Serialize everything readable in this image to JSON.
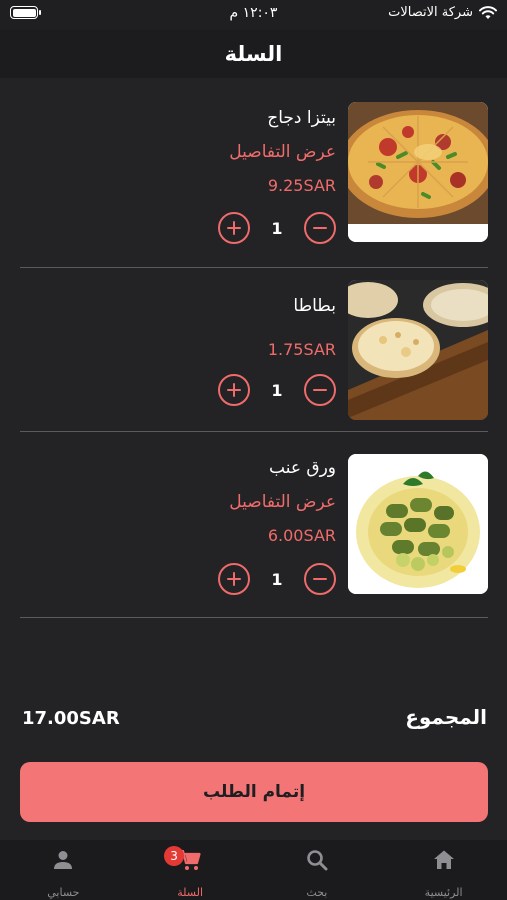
{
  "status_bar": {
    "carrier": "شركة الاتصالات",
    "time": "١٢:٠٣ م"
  },
  "header": {
    "title": "السلة"
  },
  "items": [
    {
      "name": "بيتزا دجاج",
      "details_link": "عرض التفاصيل",
      "price": "9.25SAR",
      "quantity": "1",
      "image": "pizza"
    },
    {
      "name": "بطاطا",
      "details_link": "",
      "price": "1.75SAR",
      "quantity": "1",
      "image": "manakish"
    },
    {
      "name": "ورق عنب",
      "details_link": "عرض التفاصيل",
      "price": "6.00SAR",
      "quantity": "1",
      "image": "grape-leaves"
    }
  ],
  "summary": {
    "total_label": "المجموع",
    "total_value": "17.00SAR"
  },
  "checkout": {
    "label": "إتمام الطلب"
  },
  "tabbar": {
    "tabs": [
      {
        "label": "الرئيسية",
        "icon": "home-icon"
      },
      {
        "label": "بحث",
        "icon": "search-icon"
      },
      {
        "label": "السلة",
        "icon": "cart-icon",
        "badge": "3",
        "active": true
      },
      {
        "label": "حسابي",
        "icon": "person-icon"
      }
    ]
  },
  "colors": {
    "accent": "#f06b6b",
    "button": "#f47575",
    "background": "#232325",
    "badge": "#e53935"
  }
}
